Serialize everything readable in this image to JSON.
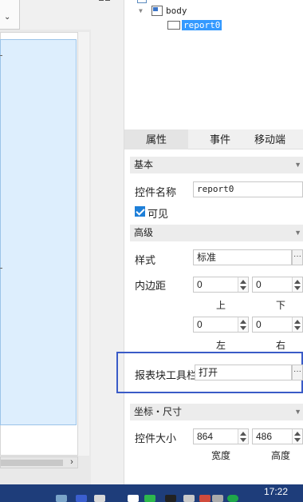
{
  "tree": {
    "body_label": "body",
    "report_label": "report0"
  },
  "tabs": [
    {
      "label": "属性"
    },
    {
      "label": "事件"
    },
    {
      "label": "移动端"
    }
  ],
  "sections": {
    "basic": "基本",
    "advanced": "高级",
    "coords": "坐标・尺寸"
  },
  "props": {
    "control_name_label": "控件名称",
    "control_name_value": "report0",
    "visible_label": "可见",
    "style_label": "样式",
    "style_value": "标准",
    "padding_label": "内边距",
    "padding_top": "0",
    "padding_bottom": "0",
    "padding_left": "0",
    "padding_right": "0",
    "top_label": "上",
    "bottom_label": "下",
    "left_label": "左",
    "right_label": "右",
    "toolbar_label": "报表块工具栏",
    "toolbar_value": "打开",
    "size_label": "控件大小",
    "width_value": "864",
    "height_value": "486",
    "width_label": "宽度",
    "height_label": "高度",
    "dots": "···"
  },
  "taskbar": {
    "time": "17:22"
  },
  "icons": {
    "scroll_right": "›",
    "chevron": "⌄"
  },
  "colors": {
    "selection": "#3399ff",
    "highlight_border": "#3a5bc7",
    "checkbox": "#1e7fd8",
    "taskbar": "#1e3d7a"
  }
}
